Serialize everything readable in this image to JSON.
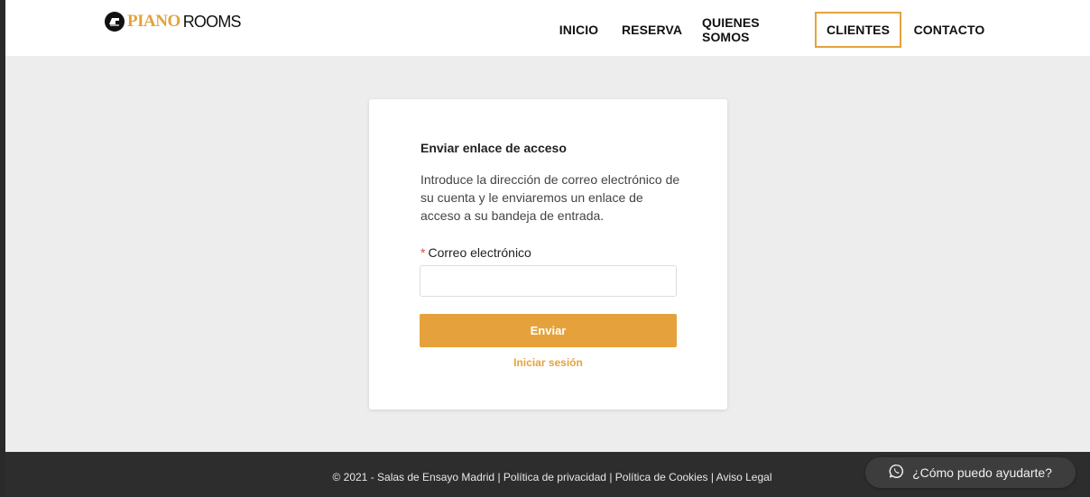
{
  "logo": {
    "part1": "PIANO",
    "part2": "ROOMS"
  },
  "nav": {
    "items": [
      {
        "label": "INICIO"
      },
      {
        "label": "RESERVA"
      },
      {
        "label": "QUIENES SOMOS"
      },
      {
        "label": "CLIENTES"
      },
      {
        "label": "CONTACTO"
      }
    ],
    "active": "CLIENTES"
  },
  "form": {
    "title": "Enviar enlace de acceso",
    "description": "Introduce la dirección de correo electrónico de su cuenta y le enviaremos un enlace de acceso a su bandeja de entrada.",
    "required_mark": "*",
    "email_label": "Correo electrónico",
    "email_value": "",
    "submit_label": "Enviar",
    "login_link": "Iniciar sesión"
  },
  "footer": {
    "copyright": "© 2021 - Salas de Ensayo Madrid",
    "separator": "|",
    "links": [
      "Política de privacidad",
      "Política de Cookies",
      "Aviso Legal"
    ]
  },
  "chat": {
    "label": "¿Cómo puedo ayudarte?"
  },
  "colors": {
    "accent": "#e5a23c",
    "footer_bg": "#2d2d2d",
    "page_bg": "#ededed"
  }
}
